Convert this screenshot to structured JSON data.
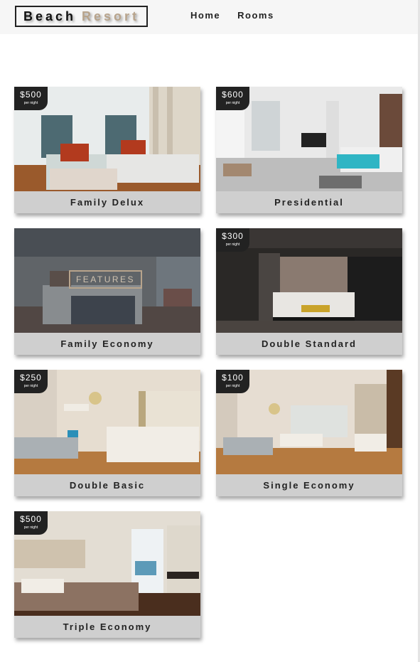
{
  "brand": {
    "word1": "Beach",
    "word2": "Resort"
  },
  "nav": {
    "home": "Home",
    "rooms": "Rooms"
  },
  "rooms": [
    {
      "name": "Family Delux",
      "price": "$500",
      "price_sub": "per night"
    },
    {
      "name": "Presidential",
      "price": "$600",
      "price_sub": "per night"
    },
    {
      "name": "Family Economy",
      "features": "FEATURES"
    },
    {
      "name": "Double Standard",
      "price": "$300",
      "price_sub": "per night"
    },
    {
      "name": "Double Basic",
      "price": "$250",
      "price_sub": "per night"
    },
    {
      "name": "Single Economy",
      "price": "$100",
      "price_sub": "per night"
    },
    {
      "name": "Triple Economy",
      "price": "$500",
      "price_sub": "per night"
    }
  ],
  "colors": {
    "accent": "#b8a48c",
    "dark": "#222222",
    "footer": "#cfcfcf"
  }
}
